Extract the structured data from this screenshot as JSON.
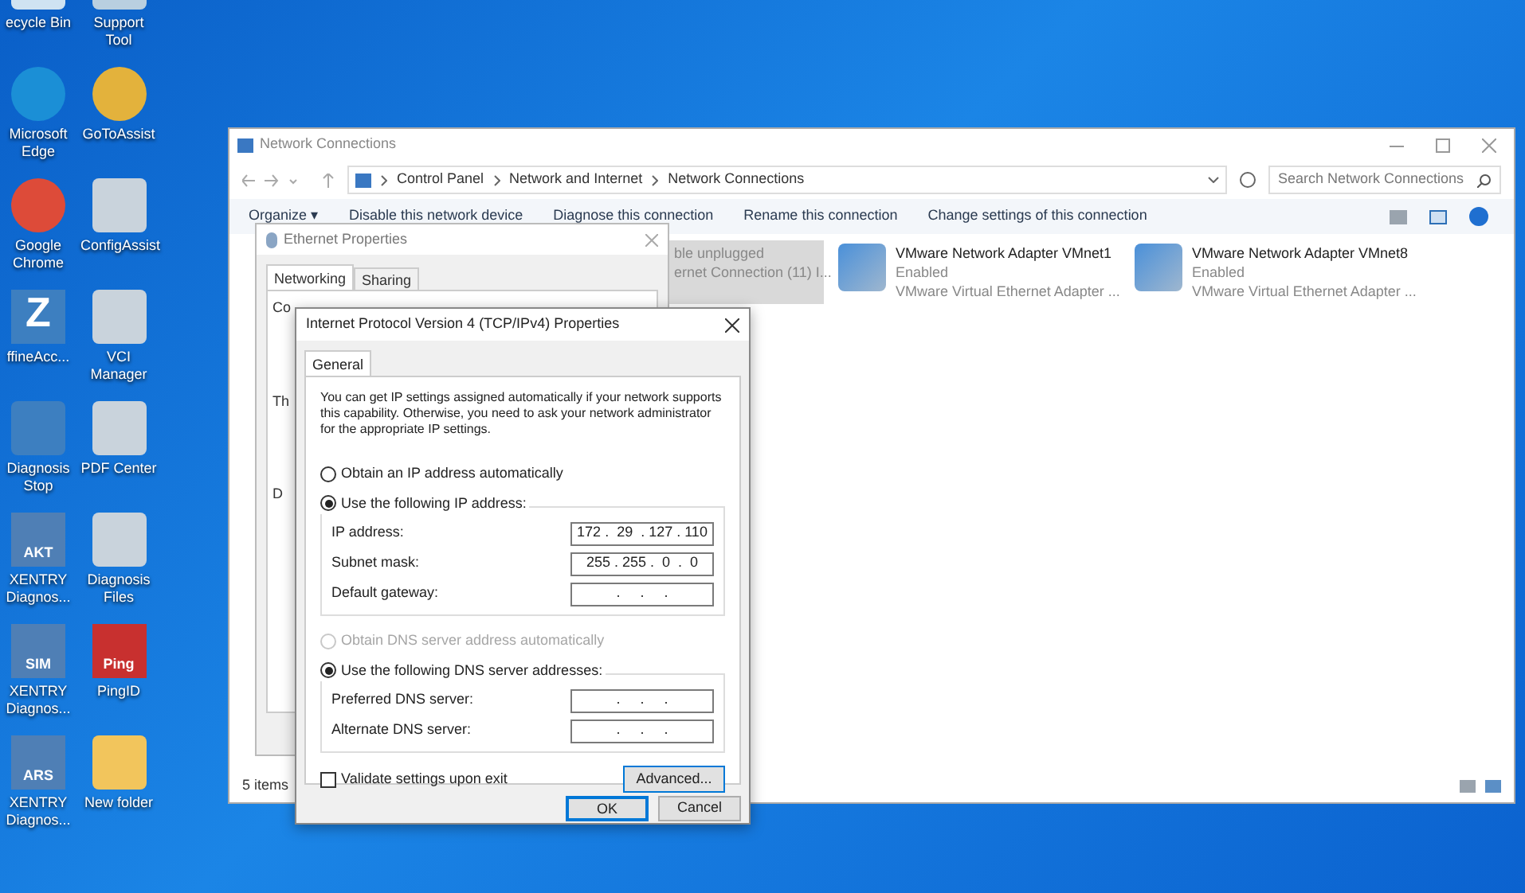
{
  "desktop_icons": [
    {
      "label": "ecycle Bin",
      "kind": "recycle"
    },
    {
      "label": "Support Tool",
      "kind": "tool"
    },
    {
      "label": "Microsoft Edge",
      "kind": "edge"
    },
    {
      "label": "GoToAssist",
      "kind": "bell"
    },
    {
      "label": "Google Chrome",
      "kind": "chrome"
    },
    {
      "label": "ConfigAssist",
      "kind": "gears"
    },
    {
      "label": "ffineAcc...",
      "kind": "letter",
      "badge": "Z"
    },
    {
      "label": "VCI Manager",
      "kind": "device"
    },
    {
      "label": "Diagnosis Stop",
      "kind": "stop"
    },
    {
      "label": "PDF Center",
      "kind": "doc"
    },
    {
      "label": "XENTRY Diagnos...",
      "kind": "xentry",
      "badge": "AKT"
    },
    {
      "label": "Diagnosis Files",
      "kind": "doc"
    },
    {
      "label": "XENTRY Diagnos...",
      "kind": "xentry",
      "badge": "SIM"
    },
    {
      "label": "PingID",
      "kind": "ping",
      "badge": "Ping"
    },
    {
      "label": "XENTRY Diagnos...",
      "kind": "xentry",
      "badge": "ARS"
    },
    {
      "label": "New folder",
      "kind": "folder"
    }
  ],
  "explorer": {
    "title": "Network Connections",
    "breadcrumb": [
      "Control Panel",
      "Network and Internet",
      "Network Connections"
    ],
    "search": {
      "placeholder": "Search Network Connections"
    },
    "toolbar": [
      "Organize ▾",
      "Disable this network device",
      "Diagnose this connection",
      "Rename this connection",
      "Change settings of this connection"
    ],
    "adapters": [
      {
        "name_line": "ble unplugged",
        "device": "ernet Connection (11) I...",
        "selected": true
      },
      {
        "name": "VMware Network Adapter VMnet1",
        "status": "Enabled",
        "device": "VMware Virtual Ethernet Adapter ...",
        "selected": false
      },
      {
        "name": "VMware Network Adapter VMnet8",
        "status": "Enabled",
        "device": "VMware Virtual Ethernet Adapter ...",
        "selected": false
      }
    ],
    "status_bar": "5 items"
  },
  "ethernet_properties": {
    "title": "Ethernet Properties",
    "tabs": [
      {
        "label": "Networking",
        "selected": true
      },
      {
        "label": "Sharing",
        "selected": false
      }
    ],
    "fragments": [
      "Co",
      "Th",
      "D"
    ]
  },
  "ipv4_dialog": {
    "title": "Internet Protocol Version 4 (TCP/IPv4) Properties",
    "tabs": [
      {
        "label": "General",
        "selected": true
      }
    ],
    "description": "You can get IP settings assigned automatically if your network supports this capability. Otherwise, you need to ask your network administrator for the appropriate IP settings.",
    "ip_options": [
      {
        "label": "Obtain an IP address automatically",
        "selected": false,
        "disabled": false
      },
      {
        "label": "Use the following IP address:",
        "selected": true,
        "disabled": false
      }
    ],
    "ip_fields": [
      {
        "label": "IP address:",
        "value": "172 .  29  . 127 . 110"
      },
      {
        "label": "Subnet mask:",
        "value": "255 . 255 .  0  .  0"
      },
      {
        "label": "Default gateway:",
        "value": ".     .     ."
      }
    ],
    "dns_options": [
      {
        "label": "Obtain DNS server address automatically",
        "selected": false,
        "disabled": true
      },
      {
        "label": "Use the following DNS server addresses:",
        "selected": true,
        "disabled": false
      }
    ],
    "dns_fields": [
      {
        "label": "Preferred DNS server:",
        "value": ".     .     ."
      },
      {
        "label": "Alternate DNS server:",
        "value": ".     .     ."
      }
    ],
    "validate": {
      "label": "Validate settings upon exit",
      "checked": false
    },
    "advanced_button": "Advanced...",
    "buttons": [
      {
        "label": "OK",
        "default": true
      },
      {
        "label": "Cancel",
        "default": false
      }
    ]
  }
}
